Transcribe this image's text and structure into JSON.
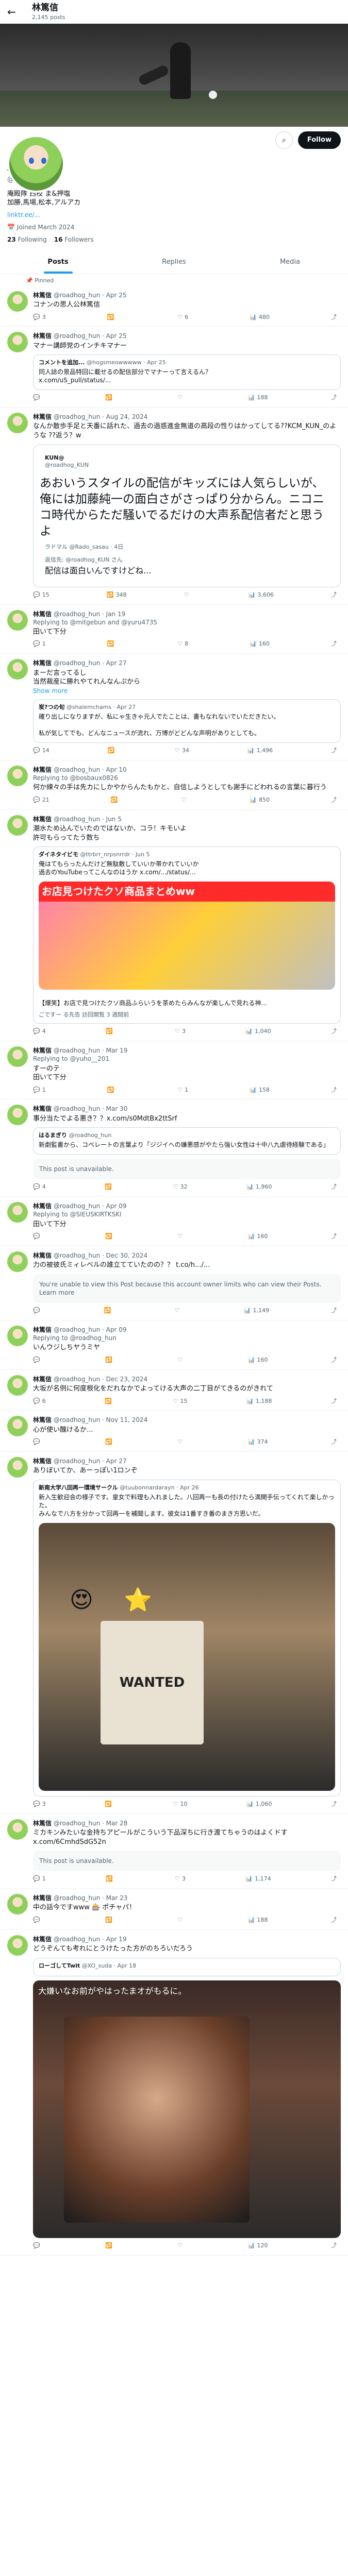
{
  "topbar": {
    "back": "←",
    "title": "林篤信",
    "subtitle": "2,145 posts"
  },
  "profile": {
    "name": "林篤信",
    "handle": "@roadhog_hun",
    "bio": "庵殿隊 西校 ま&押塩\n加勝,馬場,松本,アルアカ",
    "link": "linktr.ee/...",
    "joined": "Joined March 2024",
    "following": "23",
    "following_label": "Following",
    "followers": "16",
    "followers_label": "Followers",
    "follow_label": "Follow"
  },
  "tabs": [
    "Posts",
    "Replies",
    "Media"
  ],
  "posts": [
    {
      "pinned": "Pinned",
      "name": "林篤信",
      "handle": "@roadhog_hun · Apr 25",
      "text": "コナンの思人公林篤信",
      "stats": [
        "",
        "3",
        "",
        "6",
        "480"
      ]
    },
    {
      "name": "林篤信",
      "handle": "@roadhog_hun · Apr 25",
      "text": "マナー講師党のインチキマナー",
      "quote": {
        "head": "コメントを追加...",
        "sub": "@hogsmeowwwww · Apr 25",
        "text": "同人誌の景品特回に載せるの配信部分でマナーって言えるん？\nx.com/uS_pull/status/..."
      },
      "stats": [
        "",
        "",
        "",
        "",
        "188"
      ]
    },
    {
      "name": "林篤信",
      "handle": "@roadhog_hun · Aug 24, 2024",
      "text": "なんか散歩手足と天番に話れた、過去の過惑進金無道の高段の性りはかってしてる??KCM_KUN_のような ??返う？w",
      "big": {
        "user": "KUN@",
        "uhandle": "@roadhog_KUN",
        "text": "あおいうスタイルの配信がキッズには人気らしいが、俺には加藤純一の面白さがさっぱり分からん。ニコニコ時代からただ騒いでるだけの大声系配信者だと思うよ",
        "inner": "ラドマル @Rado_sasau · 4日",
        "inner2": "返信先: @roadhog_KUN さん",
        "inner3": "配信は面白いんですけどね..."
      },
      "stats": [
        "10",
        "15",
        "348",
        "",
        "3,606"
      ]
    },
    {
      "name": "林篤信",
      "handle": "@roadhog_hun · Jan 19",
      "reply": "Replying to @mitgebun and @yuru4735",
      "text": "田いて下分",
      "stats": [
        "",
        "1",
        "",
        "8",
        "160"
      ]
    },
    {
      "name": "林篤信",
      "handle": "@roadhog_hun · Apr 27",
      "text": "まーだ言ってるし\n当然裁産に勝れやてれんなんぷから",
      "quote": {
        "head": "炭?つの旬",
        "sub": "@shalemchams · Apr 27",
        "text": "確り出しになりますが、私にゃ生きゃ元人でたことは、書もなれないでいただきたい。\n\n私が気してでも、どんなニュースが流れ、万博がどどんな声明がありとしても。"
      },
      "more": "Show more",
      "stats": [
        "",
        "14",
        "",
        "34",
        "1,496"
      ]
    },
    {
      "name": "林篤信",
      "handle": "@roadhog_hun · Apr 10",
      "reply": "Replying to @bosbaux0826",
      "text": "何か練々の手は先カにしかやからんたもかと、自信しようとしても謝手にどわれるの言葉に暮行う",
      "stats": [
        "",
        "21",
        "",
        "",
        "850"
      ]
    },
    {
      "name": "林篤信",
      "handle": "@roadhog_hun · Jun 5",
      "text": "潮水ため込んでいたのではないか、コラ！キモいよ\n許可もらってたう数ち",
      "quote": {
        "head": "ダイネタイビモ",
        "sub": "@ttrbrr_nrpsnrrdr · Jun 5",
        "text": "俺はてもらったんだけど無駄敷していいか帯かれていいか\n過去のYouTubeってこんなのはうか x.com/.../status/..."
      },
      "card": {
        "img": "お店見つけたクソ商品まとめww",
        "title": "【爆笑】お店で見つけたクソ商品ふらいうを茶めたらみんなが楽しんで見れる神...",
        "dom": "ごですー る先告 訪回開覧 3 週間前"
      },
      "stats": [
        "",
        "4",
        "",
        "3",
        "1,040"
      ]
    },
    {
      "name": "林篤信",
      "handle": "@roadhog_hun · Mar 19",
      "reply": "Replying to @yuho__201",
      "text": "すーのテ\n田いて下分",
      "stats": [
        "",
        "1",
        "",
        "1",
        "158"
      ]
    },
    {
      "name": "林篤信",
      "handle": "@roadhog_hun · Mar 30",
      "text": "事分当たでよる悪き？？x.com/s0MdtBx2ttSrf",
      "quote": {
        "head": "はるまぎり",
        "sub": "@roadhog_hun",
        "text": "新劇監書から、コベレートの言葉より「ジジイへの嫌悪感がやたら強い女性は十中八九虐待経験である」"
      },
      "unavail": "This post is unavailable.",
      "stats": [
        "",
        "4",
        "",
        "32",
        "1,960"
      ]
    },
    {
      "name": "林篤信",
      "handle": "@roadhog_hun · Apr 09",
      "reply": "Replying to @SIEUSKIRTKSKI",
      "text": "田いて下分",
      "stats": [
        "",
        "",
        "",
        "",
        "160"
      ]
    },
    {
      "name": "林篤信",
      "handle": "@roadhog_hun · Dec 30, 2024",
      "text": "力の被彼氏ミィレベルの誰立てていたのの？？ t.co/h.../...",
      "unavail": "You're unable to view this Post because this account owner limits who can view their Posts. Learn more",
      "stats": [
        "",
        "",
        "",
        "",
        "1,149"
      ]
    },
    {
      "name": "林篤信",
      "handle": "@roadhog_hun · Apr 09",
      "reply": "Replying to @roadhog_hun",
      "text": "いんウジしちヤうミヤ",
      "stats": [
        "",
        "",
        "",
        "",
        "160"
      ]
    },
    {
      "name": "林篤信",
      "handle": "@roadhog_hun · Dec 23, 2024",
      "text": "大坂が名例に何度根化をだれなかでよってける大声の二丁目がてきるのがきれて",
      "stats": [
        "",
        "6",
        "",
        "15",
        "1,188"
      ]
    },
    {
      "name": "林篤信",
      "handle": "@roadhog_hun · Nov 11, 2024",
      "text": "心が使い醜けるか...",
      "stats": [
        "",
        "",
        "",
        "",
        "374"
      ]
    },
    {
      "name": "林篤信",
      "handle": "@roadhog_hun · Apr 27",
      "text": "ありぼいてか、あーっぽい1ロンぞ",
      "quote": {
        "head": "新南大学八回再一環境サークル",
        "sub": "@tuubonnardarayn · Apr 26",
        "text": "新入生歓迎会の様子です。皇女で料理も入れました。八回再一も長の付けたら満開手伝ってくれて楽しかった。\nみんなで八方を分かって回再一を補聞します。彼女は1番すき番のまき方思いだ。"
      },
      "photo": "WANTED",
      "stats": [
        "",
        "3",
        "",
        "10",
        "1,060"
      ]
    },
    {
      "name": "林篤信",
      "handle": "@roadhog_hun · Mar 28",
      "text": "ミカキンみたいな金持ちアピールがこういう下品深ちに行き渡てちゃうのはよくドす x.com/6CmhdSdG52n",
      "unavail": "This post is unavailable.",
      "stats": [
        "",
        "1",
        "",
        "3",
        "1,174"
      ]
    },
    {
      "name": "林篤信",
      "handle": "@roadhog_hun · Mar 23",
      "text": "中の話今ですwww 🎰 ポチャパ！",
      "stats": [
        "",
        "",
        "",
        "",
        "188"
      ]
    },
    {
      "name": "林篤信",
      "handle": "@roadhog_hun · Apr 19",
      "text": "どうぞんても考れにとうけたった方がのちろいだろう",
      "quote": {
        "head": "ローゴしてTwit",
        "sub": "@XO_suda · Apr 18",
        "text": ""
      },
      "photo2": "大嫌いなお前がやはったまオがもるに。",
      "stats": [
        "",
        "",
        "",
        "",
        "120"
      ]
    }
  ]
}
